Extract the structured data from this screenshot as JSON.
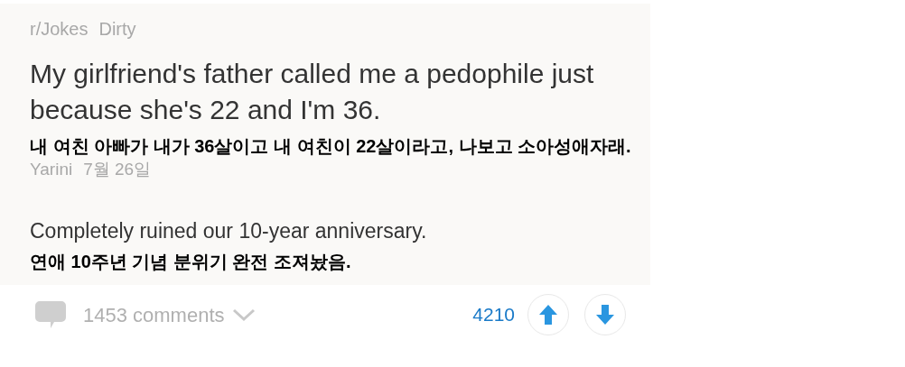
{
  "post": {
    "subreddit": "r/Jokes",
    "flair": "Dirty",
    "title": "My girlfriend's father called me a pedophile just because she's 22 and I'm 36.",
    "title_translation": "내 여친 아빠가 내가 36살이고 내 여친이 22살이라고, 나보고 소아성애자래.",
    "author": "Yarini",
    "date": "7월 26일",
    "body": "Completely ruined our 10-year anniversary.",
    "body_translation": "연애 10주년 기념 분위기 완전 조져놨음."
  },
  "footer": {
    "comments": "1453 comments",
    "score": "4210"
  }
}
